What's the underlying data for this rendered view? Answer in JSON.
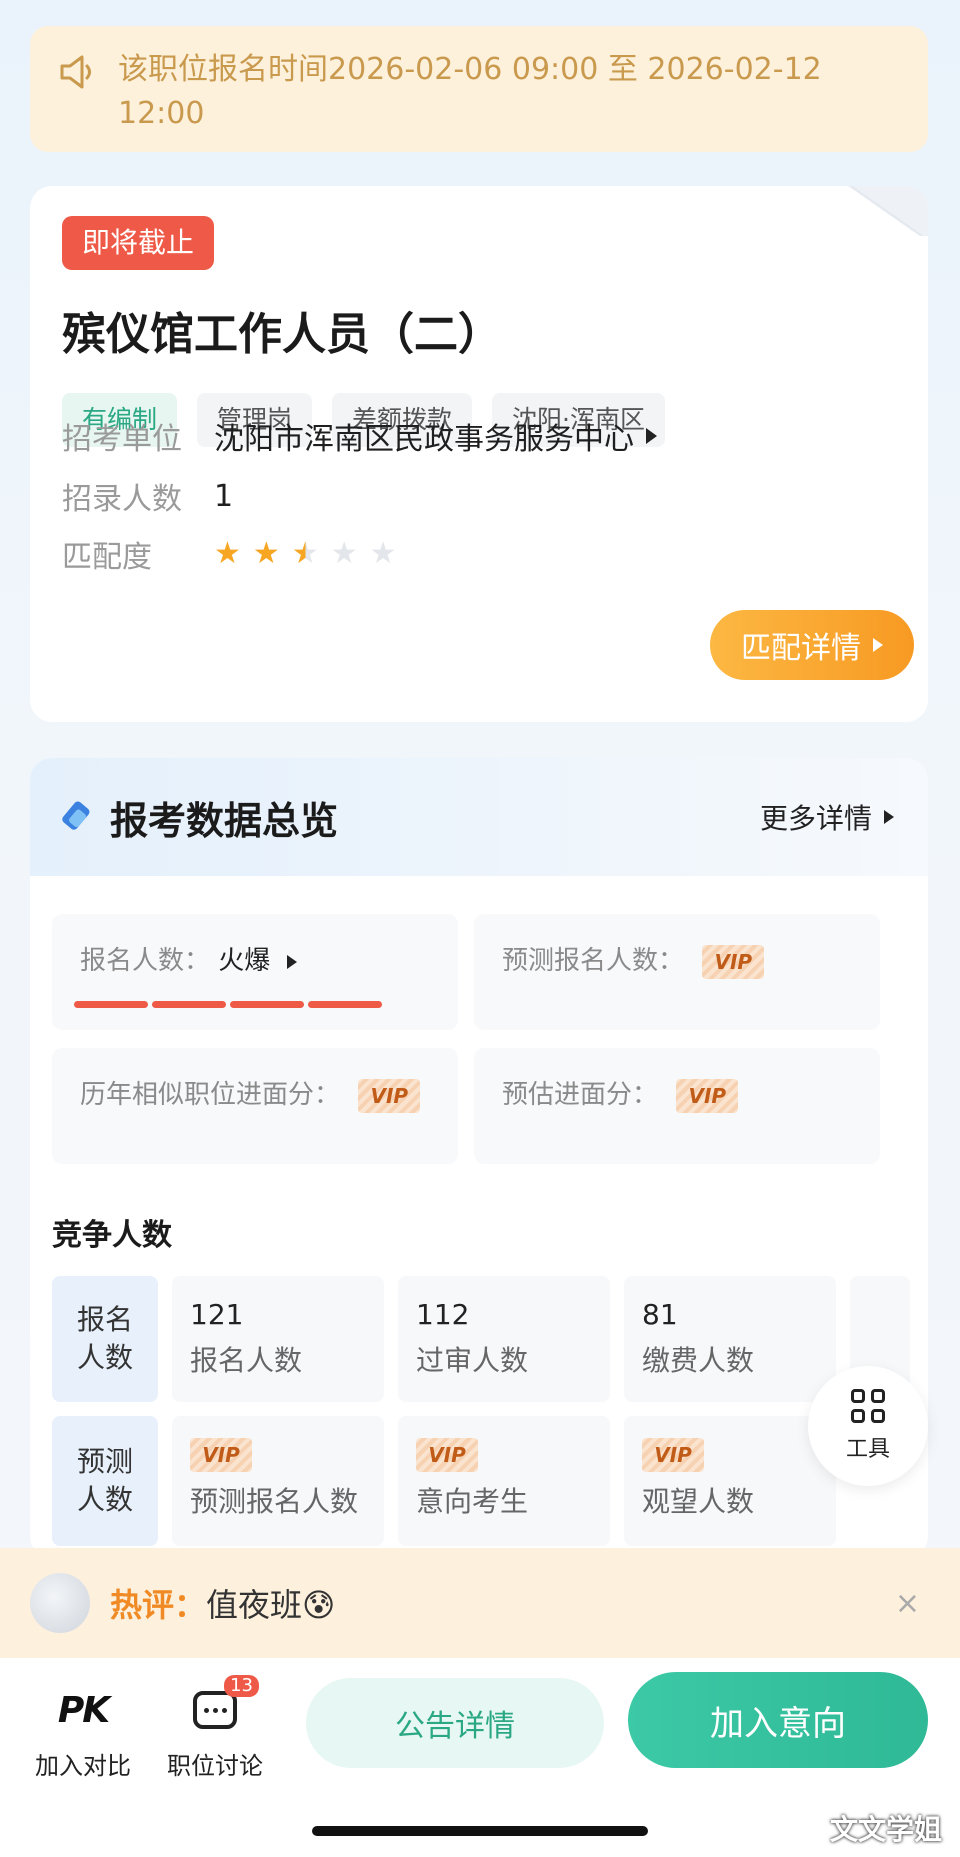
{
  "notice": {
    "text": "该职位报名时间2026-02-06 09:00 至 2026-02-12 12:00"
  },
  "job": {
    "status_badge": "即将截止",
    "title": "殡仪馆工作人员（二）",
    "tags": [
      "有编制",
      "管理岗",
      "差额拨款",
      "沈阳·浑南区"
    ],
    "unit_label": "招考单位",
    "unit_value": "沈阳市浑南区民政事务服务中心",
    "count_label": "招录人数",
    "count_value": "1",
    "match_label": "匹配度",
    "match_rating": 2.5,
    "match_rating_max": 5,
    "match_button": "匹配详情",
    "accent_color": "#f79a23"
  },
  "overview": {
    "title": "报考数据总览",
    "more": "更多详情",
    "signup_label": "报名人数：",
    "signup_value": "火爆",
    "predicted_signup_label": "预测报名人数：",
    "history_score_label": "历年相似职位进面分：",
    "estimated_score_label": "预估进面分：",
    "vip_text": "VIP"
  },
  "competition": {
    "title": "竞争人数",
    "rows": [
      {
        "header": "报名人数",
        "cells": [
          {
            "value": "121",
            "caption": "报名人数"
          },
          {
            "value": "112",
            "caption": "过审人数"
          },
          {
            "value": "81",
            "caption": "缴费人数"
          }
        ]
      },
      {
        "header": "预测人数",
        "cells": [
          {
            "value": "VIP",
            "caption": "预测报名人数"
          },
          {
            "value": "VIP",
            "caption": "意向考生"
          },
          {
            "value": "VIP",
            "caption": "观望人数"
          }
        ]
      }
    ]
  },
  "tools": {
    "label": "工具"
  },
  "hot_comment": {
    "label": "热评：",
    "content": "值夜班😰",
    "close": "×"
  },
  "bottom_bar": {
    "compare_icon": "PK",
    "compare_label": "加入对比",
    "discuss_label": "职位讨论",
    "discuss_count": "13",
    "notice_button": "公告详情",
    "join_button": "加入意向"
  },
  "watermark": "文文学姐"
}
